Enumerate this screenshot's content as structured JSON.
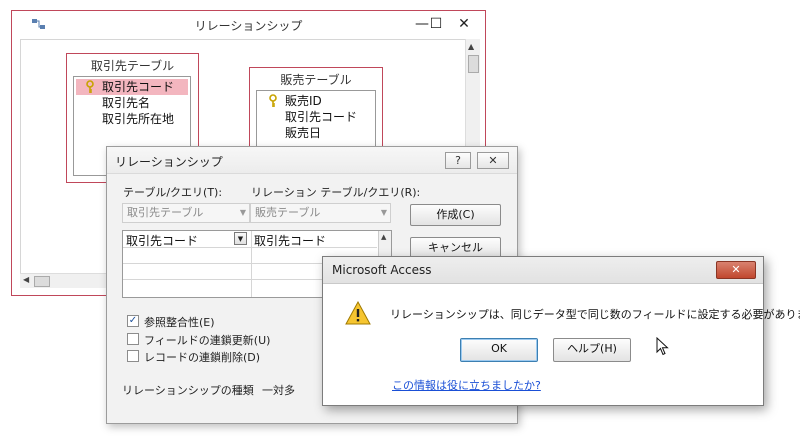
{
  "relationship_window": {
    "title": "リレーションシップ",
    "controls": {
      "minimize": "—",
      "maximize": "☐",
      "close": "✕"
    },
    "tables": [
      {
        "header": "取引先テーブル",
        "fields": [
          "取引先コード",
          "取引先名",
          "取引先所在地"
        ],
        "key_field_index": 0,
        "selected_index": 0
      },
      {
        "header": "販売テーブル",
        "fields": [
          "販売ID",
          "取引先コード",
          "販売日"
        ],
        "key_field_index": 0
      }
    ]
  },
  "edit_dialog": {
    "title": "リレーションシップ",
    "help_btn": "?",
    "close_btn": "✕",
    "table_label": "テーブル/クエリ(T):",
    "related_label": "リレーション テーブル/クエリ(R):",
    "table_combo": "取引先テーブル",
    "related_combo": "販売テーブル",
    "grid_rows": [
      {
        "left": "取引先コード",
        "right": "取引先コード"
      }
    ],
    "buttons": {
      "create": "作成(C)",
      "cancel": "キャンセル"
    },
    "checkboxes": [
      {
        "label": "参照整合性(E)",
        "checked": true
      },
      {
        "label": "フィールドの連鎖更新(U)",
        "checked": false
      },
      {
        "label": "レコードの連鎖削除(D)",
        "checked": false
      }
    ],
    "relation_type_label": "リレーションシップの種類",
    "relation_type_value": "一対多"
  },
  "message_box": {
    "title": "Microsoft Access",
    "close_btn": "✕",
    "message": "リレーションシップは、同じデータ型で同じ数のフィールドに設定する必要があります。",
    "ok_label": "OK",
    "help_label": "ヘルプ(H)",
    "link_text": "この情報は役に立ちましたか?"
  },
  "colors": {
    "accent_border": "#c0475a",
    "selected_row": "#f3b6bf",
    "link": "#1a4fd6",
    "close_red": "#c1472e"
  }
}
